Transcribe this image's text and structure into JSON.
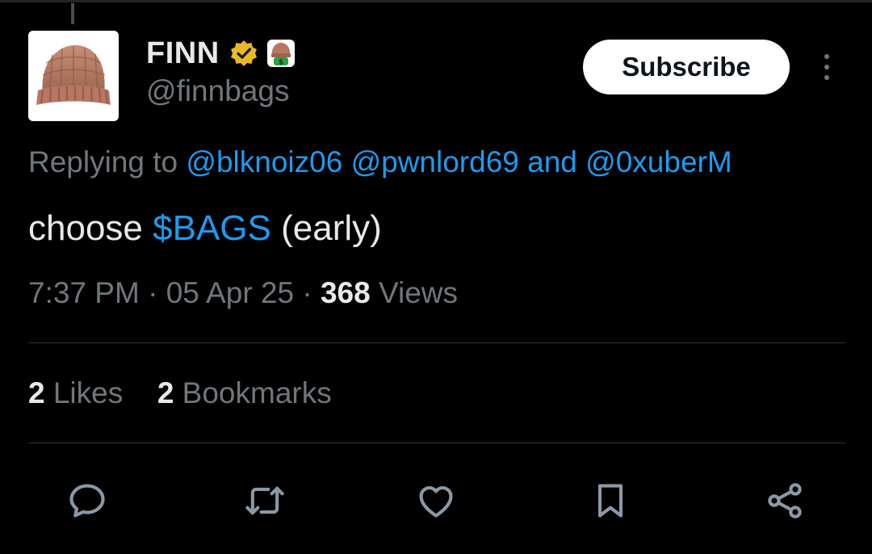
{
  "colors": {
    "background": "#000000",
    "text_primary": "#e7e9ea",
    "text_secondary": "#71767b",
    "link": "#1d9bf0",
    "divider": "#2f3336",
    "verified_badge": "#e8b829"
  },
  "author": {
    "display_name": "FINN",
    "handle": "@finnbags",
    "avatar_icon": "knit-beanie-hat",
    "badges": [
      "verified-badge-icon",
      "beanie-emoji-icon"
    ]
  },
  "header": {
    "subscribe_label": "Subscribe",
    "more_icon": "more-vertical-icon"
  },
  "reply_context": {
    "prefix": "Replying to",
    "mentions": [
      "@blknoiz06",
      "@pwnlord69"
    ],
    "conjunction": "and",
    "last_mention": "@0xuberM"
  },
  "tweet": {
    "text_before": "choose",
    "cashtag": "$BAGS",
    "text_after": "(early)"
  },
  "meta": {
    "time": "7:37 PM",
    "separator": "·",
    "date": "05 Apr 25",
    "views_count": "368",
    "views_label": "Views"
  },
  "stats": {
    "likes_count": "2",
    "likes_label": "Likes",
    "bookmarks_count": "2",
    "bookmarks_label": "Bookmarks"
  },
  "actions": [
    {
      "icon": "reply-icon"
    },
    {
      "icon": "retweet-icon"
    },
    {
      "icon": "like-icon"
    },
    {
      "icon": "bookmark-icon"
    },
    {
      "icon": "share-icon"
    }
  ]
}
